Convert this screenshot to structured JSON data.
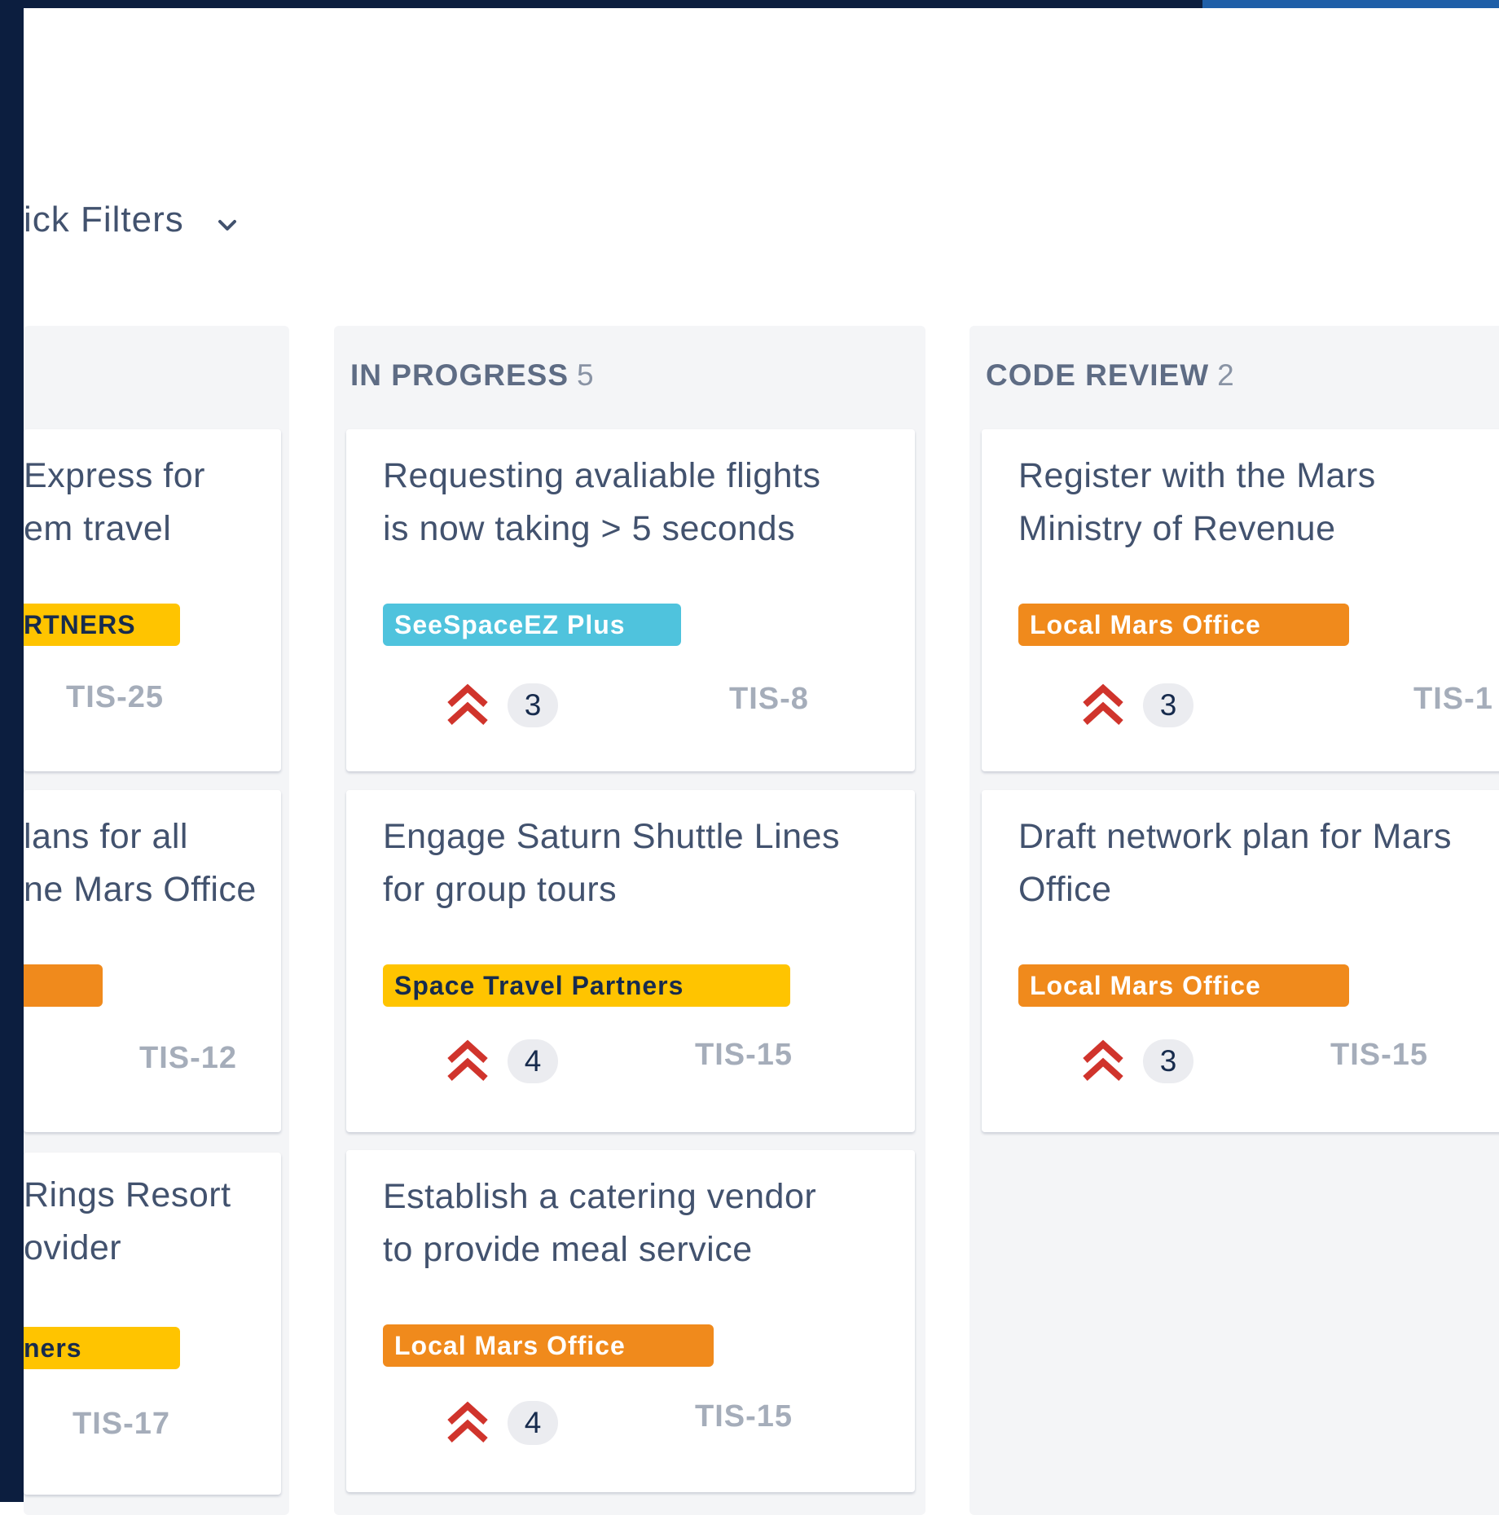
{
  "quick_filters": {
    "label": "ick Filters"
  },
  "columns": [
    {
      "name": "",
      "count": "",
      "cards": [
        {
          "title_line1": "Express for",
          "title_line2": "em travel",
          "epic": "RTNERS",
          "key": "TIS-25"
        },
        {
          "title_line1": "lans for all",
          "title_line2": "ne Mars Office",
          "epic": "",
          "key": "TIS-12"
        },
        {
          "title_line1": " Rings Resort",
          "title_line2": "ovider",
          "epic": "ners",
          "key": "TIS-17"
        }
      ]
    },
    {
      "name": "IN PROGRESS",
      "count": "5",
      "cards": [
        {
          "title_line1": "Requesting avaliable flights",
          "title_line2": "is now taking > 5 seconds",
          "epic": "SeeSpaceEZ Plus",
          "estimate": "3",
          "key": "TIS-8"
        },
        {
          "title_line1": "Engage Saturn Shuttle Lines",
          "title_line2": "for group tours",
          "epic": "Space Travel Partners",
          "estimate": "4",
          "key": "TIS-15"
        },
        {
          "title_line1": "Establish a catering vendor",
          "title_line2": "to provide meal service",
          "epic": "Local Mars Office",
          "estimate": "4",
          "key": "TIS-15"
        }
      ]
    },
    {
      "name": "CODE REVIEW",
      "count": "2",
      "cards": [
        {
          "title_line1": "Register with the Mars",
          "title_line2": "Ministry of Revenue",
          "epic": "Local Mars Office",
          "estimate": "3",
          "key": "TIS-1"
        },
        {
          "title_line1": "Draft network plan for Mars",
          "title_line2": "Office",
          "epic": "Local Mars Office",
          "estimate": "3",
          "key": "TIS-15"
        }
      ]
    }
  ],
  "colors": {
    "nav": "#0c1e3f",
    "epic_yellow": "#ffc400",
    "epic_orange": "#f08a1c",
    "epic_teal": "#4fc3dd",
    "priority_highest": "#d0342c"
  },
  "icons": {
    "priority": "priority-highest-icon",
    "filter_toggle": "chevron-down-icon"
  }
}
